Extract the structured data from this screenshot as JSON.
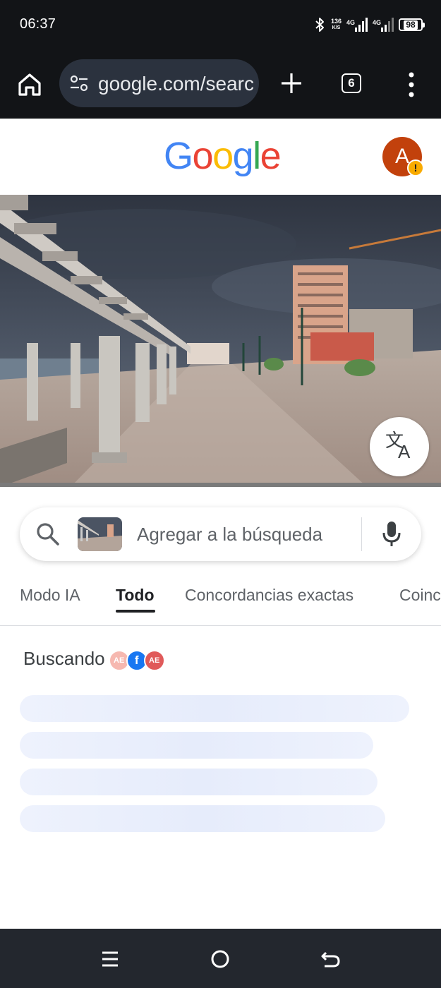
{
  "status_bar": {
    "time": "06:37",
    "net_speed_value": "136",
    "net_speed_unit": "K/S",
    "sim1_label": "4G",
    "sim2_label": "4G",
    "battery": "98",
    "bluetooth_icon": "bluetooth-icon"
  },
  "toolbar": {
    "url": "google.com/search",
    "tab_count": "6",
    "home_icon": "home-icon",
    "site_settings_icon": "tune-icon",
    "new_tab_icon": "plus-icon",
    "menu_icon": "more-vert-icon"
  },
  "google": {
    "logo_letters": [
      "G",
      "o",
      "o",
      "g",
      "l",
      "e"
    ],
    "logo_colors": [
      "#4285F4",
      "#EA4335",
      "#FBBC05",
      "#4285F4",
      "#34A853",
      "#EA4335"
    ],
    "avatar_initial": "A",
    "avatar_alert": "!"
  },
  "lens": {
    "placeholder": "Agregar a la búsqueda",
    "translate_icon": "translate-icon",
    "search_icon": "search-icon",
    "mic_icon": "mic-icon"
  },
  "tabs": [
    {
      "label": "Modo IA",
      "active": false
    },
    {
      "label": "Todo",
      "active": true
    },
    {
      "label": "Concordancias exactas",
      "active": false
    },
    {
      "label": "Coincidencias visuales",
      "active": false
    }
  ],
  "results": {
    "searching_label": "Buscando",
    "source_icons": [
      "AE",
      "f",
      "AE"
    ]
  },
  "navbar": {
    "menu_icon": "recents-icon",
    "home_icon": "home-circle-icon",
    "back_icon": "back-icon"
  }
}
